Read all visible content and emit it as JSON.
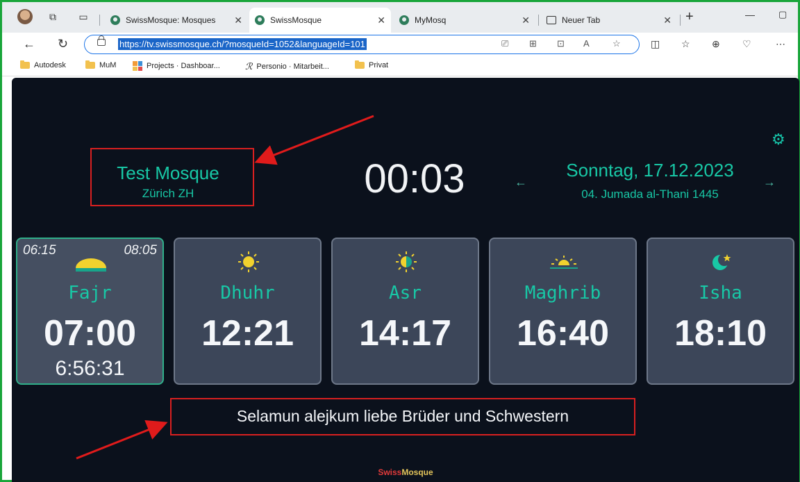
{
  "browser": {
    "tabs": [
      {
        "title": "SwissMosque: Mosques",
        "active": false
      },
      {
        "title": "SwissMosque",
        "active": true
      },
      {
        "title": "MyMosq",
        "active": false
      },
      {
        "title": "Neuer Tab",
        "active": false
      }
    ],
    "url": "https://tv.swissmosque.ch/?mosqueId=1052&languageId=101",
    "bookmarks": [
      "Autodesk",
      "MuM",
      "Projects · Dashboar...",
      "Personio · Mitarbeit...",
      "Privat"
    ]
  },
  "mosque": {
    "name": "Test Mosque",
    "city": "Zürich ZH"
  },
  "clock": "00:03",
  "date": {
    "gregorian": "Sonntag, 17.12.2023",
    "hijri": "04. Jumada al-Thani 1445",
    "prev_arrow": "←",
    "next_arrow": "→"
  },
  "prayers": [
    {
      "name": "Fajr",
      "time": "07:00",
      "window_start": "06:15",
      "window_end": "08:05",
      "countdown": "6:56:31",
      "icon": "sunrise-icon",
      "active": true
    },
    {
      "name": "Dhuhr",
      "time": "12:21",
      "icon": "sun-icon",
      "active": false
    },
    {
      "name": "Asr",
      "time": "14:17",
      "icon": "half-sun-icon",
      "active": false
    },
    {
      "name": "Maghrib",
      "time": "16:40",
      "icon": "sunset-icon",
      "active": false
    },
    {
      "name": "Isha",
      "time": "18:10",
      "icon": "crescent-star-icon",
      "active": false
    }
  ],
  "message": "Selamun alejkum liebe Brüder und Schwestern",
  "logo": {
    "part1": "Swiss",
    "part2": "Mosque"
  },
  "colors": {
    "accent": "#18c8a6",
    "background": "#0b111c",
    "card": "#3c4659",
    "annotation": "#d92020",
    "frame": "#19a53a"
  }
}
